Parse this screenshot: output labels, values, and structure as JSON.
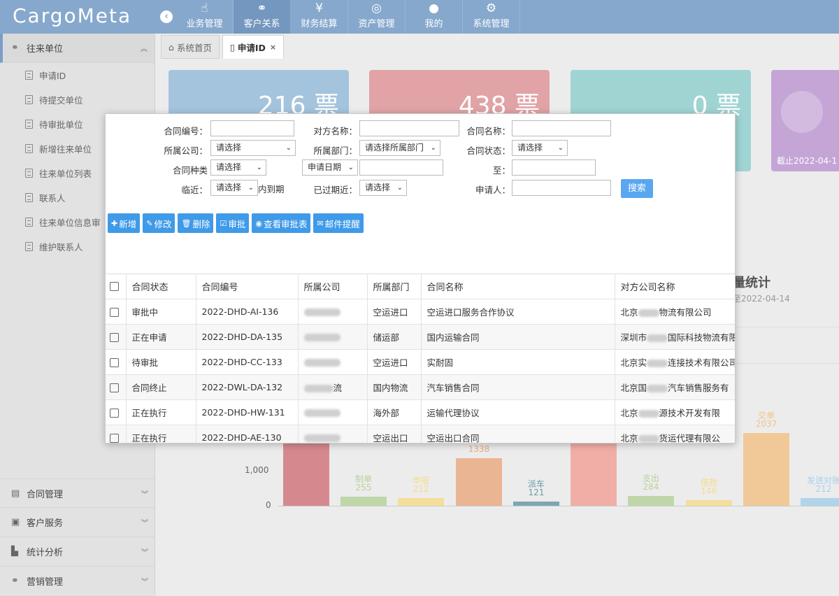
{
  "app": {
    "logo": "CargoMeta"
  },
  "nav": [
    {
      "label": "业务管理",
      "icon": "hand-pointer-icon"
    },
    {
      "label": "客户关系",
      "icon": "handshake-icon",
      "active": true
    },
    {
      "label": "财务结算",
      "icon": "yen-icon"
    },
    {
      "label": "资产管理",
      "icon": "basketball-icon"
    },
    {
      "label": "我的",
      "icon": "user-icon"
    },
    {
      "label": "系统管理",
      "icon": "gear-icon"
    }
  ],
  "sidebar": {
    "open_section": "往来单位",
    "items": [
      "申请ID",
      "待提交单位",
      "待审批单位",
      "新增往来单位",
      "往来单位列表",
      "联系人",
      "往来单位信息审",
      "维护联系人"
    ],
    "sections": [
      "合同管理",
      "客户服务",
      "统计分析",
      "营销管理"
    ]
  },
  "tabs": [
    {
      "label": "系统首页",
      "icon": "home-icon"
    },
    {
      "label": "申请ID",
      "icon": "file-icon",
      "active": true
    }
  ],
  "cards": [
    {
      "value": "216 票",
      "color": "#a4c4dd"
    },
    {
      "value": "438 票",
      "color": "#e1a3a6"
    },
    {
      "value": "0 票",
      "color": "#9fd4d3"
    },
    {
      "value": "",
      "color": "#c4a5d6",
      "footer": "截止2022-04-1"
    }
  ],
  "chart_bg": {
    "title": "量统计",
    "subtitle": "至2022-04-14",
    "ytick_labels": [
      "1,000",
      "0"
    ],
    "bars": [
      {
        "label": "",
        "value": "",
        "color": "#d1787e"
      },
      {
        "label": "制单",
        "value": "255",
        "color": "#b7d39c"
      },
      {
        "label": "申报",
        "value": "212",
        "color": "#f6dc8e"
      },
      {
        "label": "",
        "value": "1338",
        "color": "#e9ac84"
      },
      {
        "label": "派车",
        "value": "121",
        "color": "#6b9aa7"
      },
      {
        "label": "",
        "value": "",
        "color": "#f2a39a"
      },
      {
        "label": "支出",
        "value": "284",
        "color": "#b7d39c"
      },
      {
        "label": "借款",
        "value": "146",
        "color": "#f6dc8e"
      },
      {
        "label": "交单",
        "value": "2037",
        "color": "#f2c28a"
      },
      {
        "label": "发送对账",
        "value": "212",
        "color": "#a6d1ea"
      }
    ]
  },
  "filters": {
    "contract_no": "合同编号：",
    "counterparty": "对方名称：",
    "contract_name": "合同名称：",
    "company": "所属公司：",
    "company_value": "请选择",
    "dept": "所属部门：",
    "dept_value": "请选择所属部门",
    "status": "合同状态：",
    "status_value": "请选择",
    "type": "合同种类",
    "type_value": "请选择",
    "date_type_value": "申请日期",
    "to": "至：",
    "near": "临近：",
    "near_value": "请选择",
    "near_suffix": "内到期",
    "expired": "已过期近：",
    "expired_value": "请选择",
    "applicant": "申请人：",
    "search": "搜索"
  },
  "toolbar": [
    {
      "label": "新增",
      "icon": "plus-icon"
    },
    {
      "label": "修改",
      "icon": "pencil-icon"
    },
    {
      "label": "删除",
      "icon": "trash-icon"
    },
    {
      "label": "审批",
      "icon": "check-square-icon"
    },
    {
      "label": "查看审批表",
      "icon": "eye-icon"
    },
    {
      "label": "邮件提醒",
      "icon": "envelope-icon"
    }
  ],
  "table": {
    "headers": [
      "合同状态",
      "合同编号",
      "所属公司",
      "所属部门",
      "合同名称",
      "对方公司名称"
    ],
    "rows": [
      [
        "审批中",
        "2022-DHD-AI-136",
        "",
        "空运进口",
        "空运进口服务合作协议",
        [
          "北京",
          "物流有限公司"
        ]
      ],
      [
        "正在申请",
        "2022-DHD-DA-135",
        "",
        "储运部",
        "国内运输合同",
        [
          "深圳市",
          "国际科技物流有限"
        ]
      ],
      [
        "待审批",
        "2022-DHD-CC-133",
        "",
        "空运进口",
        "实耐固",
        [
          "北京实",
          "连接技术有限公司"
        ]
      ],
      [
        "合同终止",
        "2022-DWL-DA-132",
        "流",
        "国内物流",
        "汽车销售合同",
        [
          "北京国",
          "汽车销售服务有"
        ]
      ],
      [
        "正在执行",
        "2022-DHD-HW-131",
        "",
        "海外部",
        "运输代理协议",
        [
          "北京",
          "源技术开发有限"
        ]
      ],
      [
        "正在执行",
        "2022-DHD-AE-130",
        "",
        "空运出口",
        "空运出口合同",
        [
          "北京",
          "货运代理有限公"
        ]
      ]
    ]
  }
}
